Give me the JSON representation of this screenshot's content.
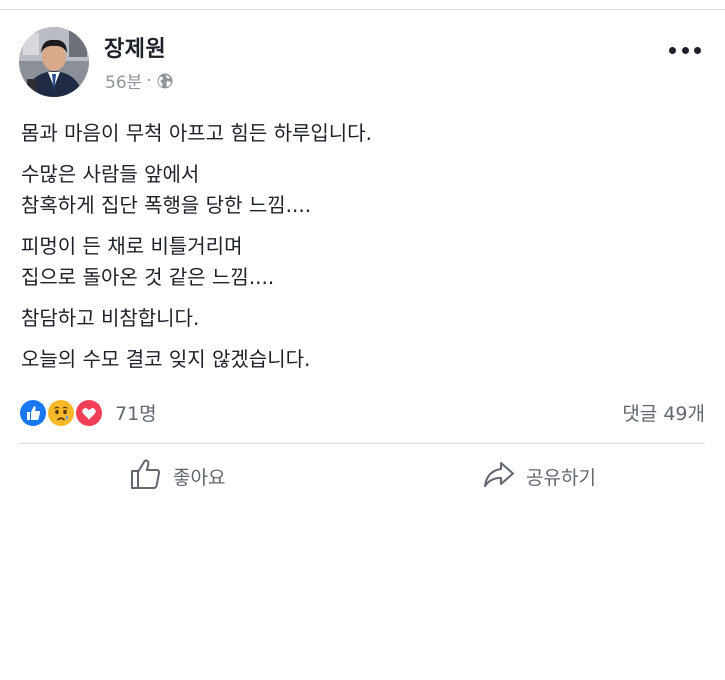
{
  "post": {
    "author": "장제원",
    "time": "56분",
    "separator": "·",
    "privacy_icon": "globe-icon",
    "menu_icon": "more-options-icon",
    "paragraphs": [
      [
        "몸과 마음이 무척 아프고 힘든 하루입니다."
      ],
      [
        "수많은 사람들 앞에서",
        "참혹하게 집단 폭행을 당한 느낌...."
      ],
      [
        "피멍이 든 채로 비틀거리며",
        "집으로 돌아온 것 같은 느낌...."
      ],
      [
        "참담하고 비참합니다."
      ],
      [
        "오늘의 수모 결코 잊지 않겠습니다."
      ]
    ]
  },
  "reactions": {
    "icons": [
      "like-reaction-icon",
      "sad-reaction-icon",
      "love-reaction-icon"
    ],
    "count": "71명",
    "comments": "댓글 49개"
  },
  "actions": {
    "like_label": "좋아요",
    "share_label": "공유하기"
  },
  "colors": {
    "like_blue": "#1877f2",
    "sad_yellow": "#f7b928",
    "love_red": "#f33e58",
    "muted_text": "#606770",
    "divider": "#dadde1"
  }
}
